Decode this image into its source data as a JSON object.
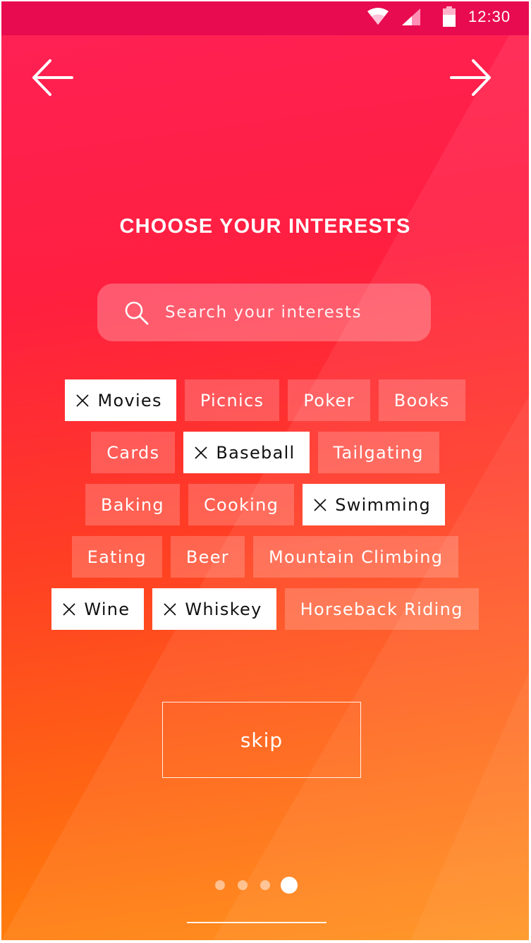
{
  "status_bar": {
    "time": "12:30",
    "icons": [
      "wifi-icon",
      "cellular-signal-icon",
      "battery-icon"
    ]
  },
  "nav": {
    "back_icon": "arrow-left-icon",
    "next_icon": "arrow-right-icon"
  },
  "title": "CHOOSE YOUR INTERESTS",
  "search": {
    "placeholder": "Search your interests",
    "icon": "search-icon"
  },
  "interests": {
    "rows": [
      [
        {
          "label": "Movies",
          "selected": true
        },
        {
          "label": "Picnics",
          "selected": false
        },
        {
          "label": "Poker",
          "selected": false
        },
        {
          "label": "Books",
          "selected": false
        }
      ],
      [
        {
          "label": "Cards",
          "selected": false
        },
        {
          "label": "Baseball",
          "selected": true
        },
        {
          "label": "Tailgating",
          "selected": false
        }
      ],
      [
        {
          "label": "Baking",
          "selected": false
        },
        {
          "label": "Cooking",
          "selected": false
        },
        {
          "label": "Swimming",
          "selected": true
        }
      ],
      [
        {
          "label": "Eating",
          "selected": false
        },
        {
          "label": "Beer",
          "selected": false
        },
        {
          "label": "Mountain Climbing",
          "selected": false
        }
      ],
      [
        {
          "label": "Wine",
          "selected": true
        },
        {
          "label": "Whiskey",
          "selected": true
        },
        {
          "label": "Horseback Riding",
          "selected": false
        }
      ]
    ]
  },
  "skip_label": "skip",
  "pagination": {
    "count": 4,
    "active": 4
  },
  "colors": {
    "status_bar": "#e80b50",
    "gradient_top": "#ff2157",
    "gradient_middle": "#ff1f3f",
    "gradient_bottom": "#ff8a0a",
    "selected_chip": "#ffffff",
    "unselected_chip": "rgba(255,255,255,0.2)"
  }
}
